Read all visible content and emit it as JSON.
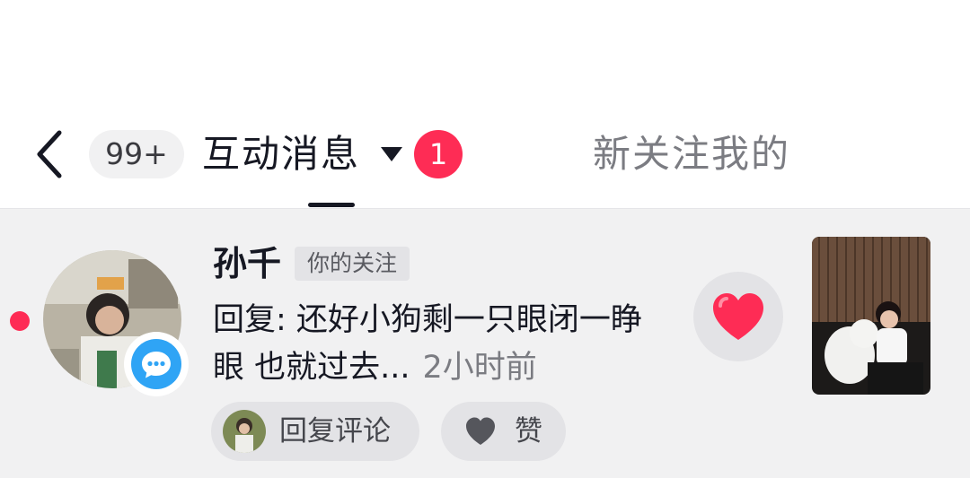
{
  "header": {
    "count_badge": "99+",
    "active_tab": "互动消息",
    "active_tab_badge": "1",
    "other_tab": "新关注我的"
  },
  "notification": {
    "username": "孙千",
    "relation_tag": "你的关注",
    "reply_text": "回复: 还好小狗剩一只眼闭一睁眼 也就过去...",
    "time": "2小时前",
    "actions": {
      "reply_label": "回复评论",
      "like_label": "赞"
    },
    "unread": true
  },
  "colors": {
    "accent": "#fe2c55",
    "chat_badge": "#2fa4f5",
    "text_primary": "#161823",
    "text_secondary": "#7b7c82",
    "item_background": "#f1f1f2"
  },
  "icons": {
    "back": "chevron-left-icon",
    "caret": "caret-down-icon",
    "chat": "chat-bubble-icon",
    "like": "heart-icon"
  }
}
